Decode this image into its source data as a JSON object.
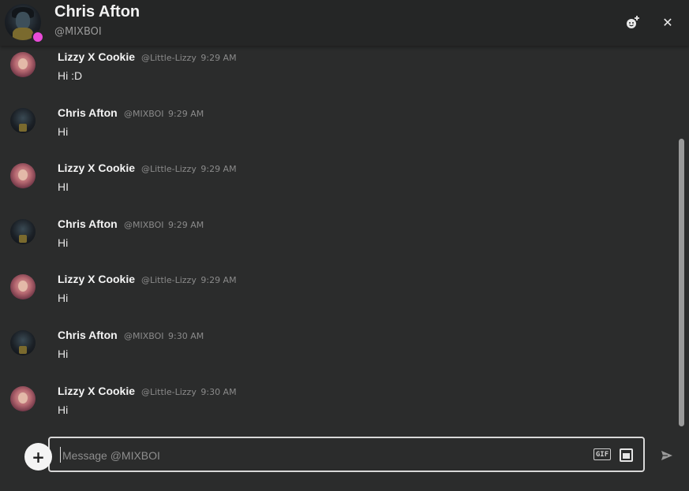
{
  "header": {
    "name": "Chris Afton",
    "handle": "@MIXBOI",
    "status_color": "#e94bd8"
  },
  "icons": {
    "add_friend": "add-friend-icon",
    "close": "close-icon",
    "add": "plus-icon",
    "gif": "gif-icon",
    "sticker": "sticker-icon",
    "send": "send-icon"
  },
  "icon_glyphs": {
    "close": "✕",
    "add": "+",
    "gif": "GIF"
  },
  "messages": [
    {
      "author": "Lizzy X Cookie",
      "handle": "@Little-Lizzy",
      "time": "9:29 AM",
      "text": "Hi :D",
      "avatar": "lizzy"
    },
    {
      "author": "Chris Afton",
      "handle": "@MIXBOI",
      "time": "9:29 AM",
      "text": "Hi",
      "avatar": "chris"
    },
    {
      "author": "Lizzy X Cookie",
      "handle": "@Little-Lizzy",
      "time": "9:29 AM",
      "text": "HI",
      "avatar": "lizzy"
    },
    {
      "author": "Chris Afton",
      "handle": "@MIXBOI",
      "time": "9:29 AM",
      "text": "Hi",
      "avatar": "chris"
    },
    {
      "author": "Lizzy X Cookie",
      "handle": "@Little-Lizzy",
      "time": "9:29 AM",
      "text": "Hi",
      "avatar": "lizzy"
    },
    {
      "author": "Chris Afton",
      "handle": "@MIXBOI",
      "time": "9:30 AM",
      "text": "Hi",
      "avatar": "chris"
    },
    {
      "author": "Lizzy X Cookie",
      "handle": "@Little-Lizzy",
      "time": "9:30 AM",
      "text": "Hi",
      "avatar": "lizzy"
    }
  ],
  "composer": {
    "placeholder": "Message @MIXBOI",
    "value": ""
  }
}
